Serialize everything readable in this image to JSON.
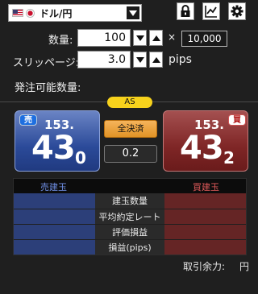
{
  "header": {
    "pair": "ドル/円",
    "icons": [
      "flag-us-icon",
      "flag-jp-icon",
      "lock-icon",
      "chart-icon",
      "gear-icon"
    ]
  },
  "order": {
    "quantity_label": "数量:",
    "quantity_value": "100",
    "multiply_sign": "×",
    "lot_value": "10,000",
    "slippage_label": "スリッページ:",
    "slippage_value": "3.0",
    "slippage_unit": "pips",
    "available_label": "発注可能数量:"
  },
  "rate": {
    "badge": "AS",
    "sell": {
      "tag": "売",
      "prefix": "153.",
      "big": "43",
      "tail": "0"
    },
    "buy": {
      "tag": "買",
      "prefix": "153.",
      "big": "43",
      "tail": "2"
    },
    "close_all_label": "全決済",
    "spread": "0.2"
  },
  "positions": {
    "sell_header": "売建玉",
    "buy_header": "買建玉",
    "rows": [
      "建玉数量",
      "平均約定レート",
      "評価損益",
      "損益(pips)"
    ]
  },
  "footer": {
    "margin_label": "取引余力:",
    "margin_unit": "円"
  },
  "colors": {
    "sell": "#2b4a99",
    "buy": "#7f2626",
    "accent": "#f7d21c",
    "close_all": "#f0a540"
  }
}
